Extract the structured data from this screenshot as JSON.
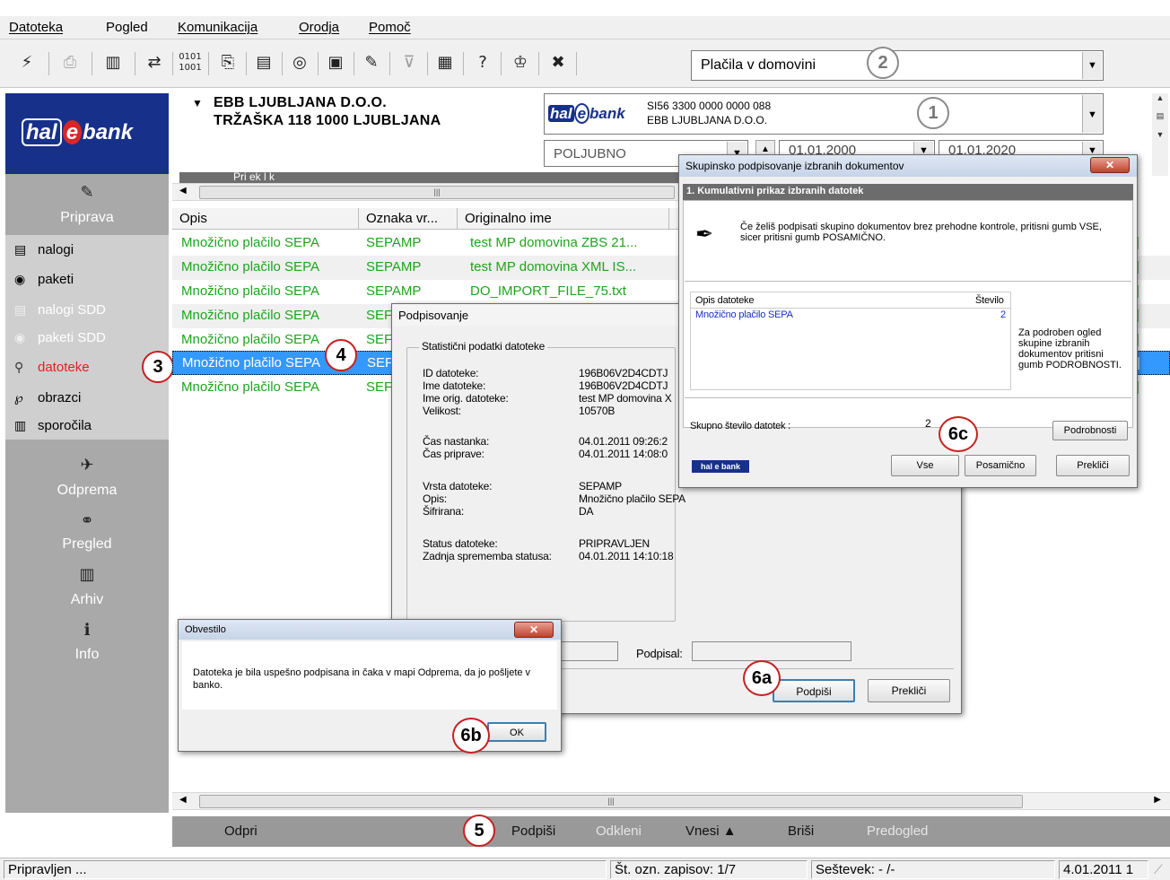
{
  "menu": [
    "Datoteka",
    "Pogled",
    "Komunikacija",
    "Orodja",
    "Pomoč"
  ],
  "toolbar": {
    "icons": [
      "lightning-icon",
      "printer-icon",
      "book-icon",
      "exchange-icon",
      "binary-icon",
      "stamp-icon",
      "form-icon",
      "reel-icon",
      "cash-icon",
      "edit-icon",
      "filter-icon",
      "calculator-icon",
      "help-icon",
      "tag-icon",
      "close-x-icon"
    ],
    "payment_type": "Plačila v domovini"
  },
  "logo": {
    "text_a": "hal",
    "text_b": "e",
    "text_c": "bank"
  },
  "company": {
    "name": "EBB LJUBLJANA D.O.O.",
    "address": "TRŽAŠKA 118 1000 LJUBLJANA"
  },
  "account": {
    "iban": "SI56 3300 0000 0000 088",
    "owner": "EBB LJUBLJANA D.O.O.",
    "bank_logo": "hal e bank"
  },
  "filters": {
    "status": "POLJUBNO",
    "date_from": "01.01.2000",
    "date_to": "01.01.2020"
  },
  "sidebar": {
    "priprava": "Priprava",
    "items": [
      {
        "label": "nalogi",
        "icon": "order-icon",
        "state": "normal"
      },
      {
        "label": "paketi",
        "icon": "package-icon",
        "state": "normal"
      },
      {
        "label": "nalogi SDD",
        "icon": "order-sdd-icon",
        "state": "disabled"
      },
      {
        "label": "paketi SDD",
        "icon": "package-sdd-icon",
        "state": "disabled"
      },
      {
        "label": "datoteke",
        "icon": "magnifier-icon",
        "state": "active"
      },
      {
        "label": "obrazci",
        "icon": "form-icon",
        "state": "normal"
      },
      {
        "label": "sporočila",
        "icon": "message-icon",
        "state": "normal"
      }
    ],
    "odprema": "Odprema",
    "pregled": "Pregled",
    "arhiv": "Arhiv",
    "info": "Info"
  },
  "grid": {
    "columns": [
      "Opis",
      "Oznaka vr...",
      "Originalno ime"
    ],
    "rows": [
      {
        "opis": "Množično plačilo SEPA",
        "oznaka": "SEPAMP",
        "ime": "test MP domovina ZBS 21..."
      },
      {
        "opis": "Množično plačilo SEPA",
        "oznaka": "SEPAMP",
        "ime": "test MP domovina XML IS..."
      },
      {
        "opis": "Množično plačilo SEPA",
        "oznaka": "SEPAMP",
        "ime": "DO_IMPORT_FILE_75.txt"
      },
      {
        "opis": "Množično plačilo SEPA",
        "oznaka": "SEF",
        "ime": ""
      },
      {
        "opis": "Množično plačilo SEPA",
        "oznaka": "SEF",
        "ime": ""
      },
      {
        "opis": "Množično plačilo SEPA",
        "oznaka": "SEF",
        "ime": ""
      },
      {
        "opis": "Množično plačilo SEPA",
        "oznaka": "SEF",
        "ime": ""
      }
    ],
    "selected_row": 5,
    "hidden_title": "Pri           ek  l  k"
  },
  "actionbar": {
    "odpri": "Odpri",
    "podpisi": "Podpiši",
    "odkleni": "Odkleni",
    "vnesi": "Vnesi ▲",
    "brisi": "Briši",
    "predogled": "Predogled"
  },
  "statusbar": {
    "status": "Pripravljen ...",
    "count": "Št. ozn. zapisov: 1/7",
    "sum": "Seštevek: - /-",
    "date": "4.01.2011 1"
  },
  "podpisovanje": {
    "title": "Podpisovanje",
    "group": "Statistični podatki datoteke",
    "fields": [
      {
        "label": "ID datoteke:",
        "value": "196B06V2D4CDTJ"
      },
      {
        "label": "Ime datoteke:",
        "value": "196B06V2D4CDTJ"
      },
      {
        "label": "Ime orig. datoteke:",
        "value": "test MP domovina X"
      },
      {
        "label": "Velikost:",
        "value": "10570B"
      },
      {
        "label": "Čas nastanka:",
        "value": "04.01.2011 09:26:2"
      },
      {
        "label": "Čas priprave:",
        "value": "04.01.2011 14:08:0"
      },
      {
        "label": "Vrsta datoteke:",
        "value": "SEPAMP"
      },
      {
        "label": "Opis:",
        "value": "Množično plačilo SEPA"
      },
      {
        "label": "Šifrirana:",
        "value": "DA"
      },
      {
        "label": "Status datoteke:",
        "value": "PRIPRAVLJEN"
      },
      {
        "label": "Zadnja sprememba statusa:",
        "value": "04.01.2011 14:10:18"
      }
    ],
    "podpisal_label": "Podpisal:",
    "sign_button": "Podpiši",
    "cancel_button": "Prekliči"
  },
  "skupinsko": {
    "title": "Skupinsko podpisovanje izbranih dokumentov",
    "section": "1. Kumulativni prikaz izbranih datotek",
    "instruction": "Če želiš podpisati skupino dokumentov brez prehodne kontrole, pritisni gumb VSE, sicer pritisni gumb POSAMIČNO.",
    "col_opis": "Opis datoteke",
    "col_stevilo": "Število",
    "item_opis": "Množično plačilo SEPA",
    "item_count": "2",
    "hint": "Za podroben ogled skupine izbranih dokumentov pritisni gumb PODROBNOSTI.",
    "total_label": "Skupno število datotek :",
    "total_value": "2",
    "btn_details": "Podrobnosti",
    "btn_all": "Vse",
    "btn_single": "Posamično",
    "btn_cancel": "Prekliči",
    "logo": "hal e bank"
  },
  "obvestilo": {
    "title": "Obvestilo",
    "message": "Datoteka je bila uspešno podpisana in čaka v mapi Odprema, da jo pošljete v banko.",
    "ok": "OK"
  },
  "callouts": {
    "c1": "1",
    "c2": "2",
    "c3": "3",
    "c4": "4",
    "c5": "5",
    "c6a": "6a",
    "c6b": "6b",
    "c6c": "6c"
  },
  "colors": {
    "accent_red": "#c72020",
    "grid_green": "#1fa31f",
    "selection_blue": "#3399ff",
    "sidebar_gray": "#a9a9a9",
    "logo_blue": "#17318a"
  }
}
